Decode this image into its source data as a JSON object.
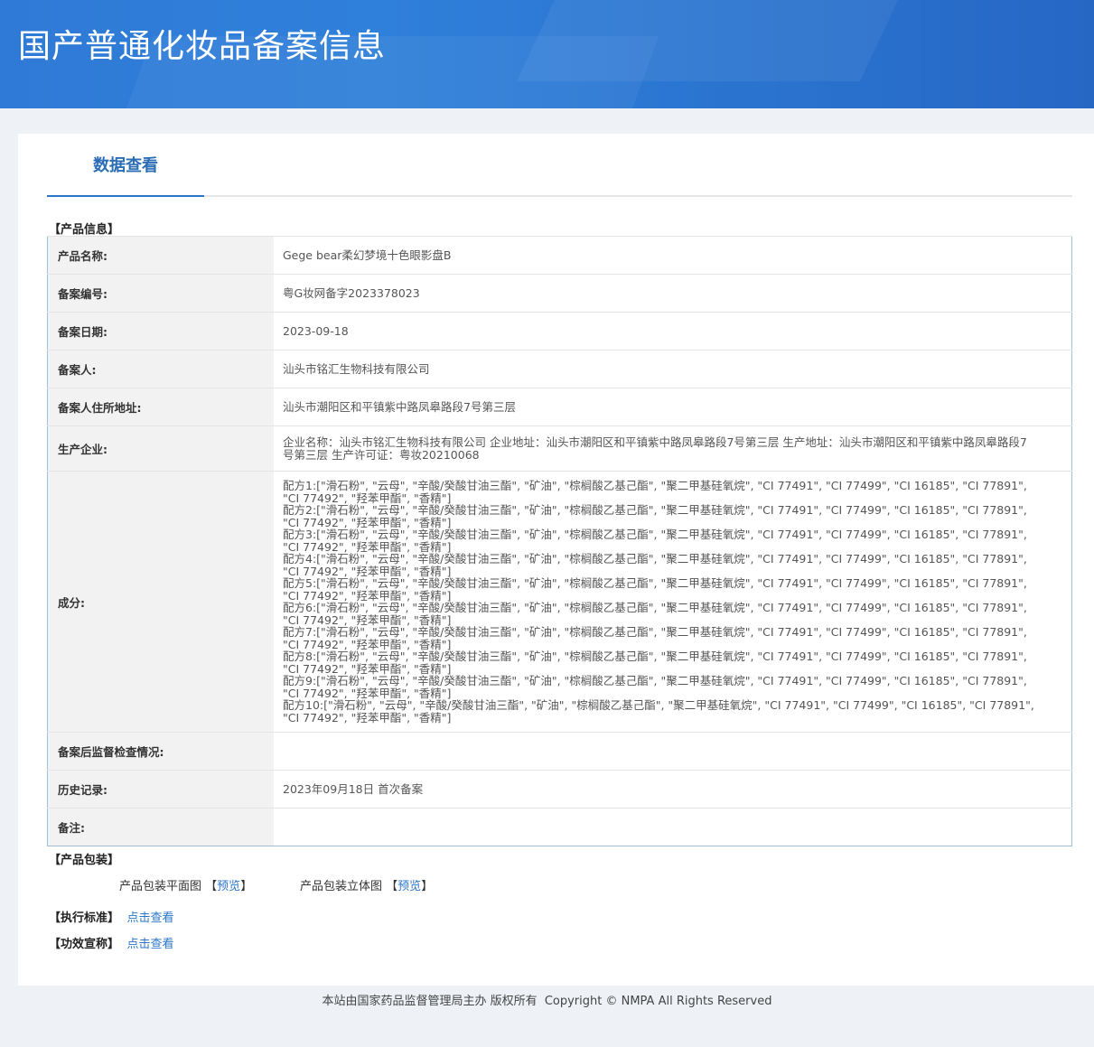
{
  "header": {
    "title": "国产普通化妆品备案信息"
  },
  "tabs": {
    "active": "数据查看"
  },
  "product_section": {
    "title": "【产品信息】"
  },
  "rows": {
    "name": {
      "label": "产品名称:",
      "value": "Gege bear柔幻梦境十色眼影盘B"
    },
    "record_no": {
      "label": "备案编号:",
      "value": "粤G妆网备字2023378023"
    },
    "record_date": {
      "label": "备案日期:",
      "value": "2023-09-18"
    },
    "registrant": {
      "label": "备案人:",
      "value": "汕头市铭汇生物科技有限公司"
    },
    "address": {
      "label": "备案人住所地址:",
      "value": "汕头市潮阳区和平镇紫中路凤皋路段7号第三层"
    },
    "manufacturer": {
      "label": "生产企业:",
      "value": "企业名称：汕头市铭汇生物科技有限公司 企业地址：汕头市潮阳区和平镇紫中路凤皋路段7号第三层 生产地址：汕头市潮阳区和平镇紫中路凤皋路段7号第三层 生产许可证：粤妆20210068"
    },
    "ingredients": {
      "label": "成分:",
      "formulas": [
        "配方1:[\"滑石粉\", \"云母\", \"辛酸/癸酸甘油三酯\", \"矿油\", \"棕榈酸乙基己酯\", \"聚二甲基硅氧烷\", \"CI 77491\", \"CI 77499\", \"CI 16185\", \"CI 77891\", \"CI 77492\", \"羟苯甲酯\", \"香精\"]",
        "配方2:[\"滑石粉\", \"云母\", \"辛酸/癸酸甘油三酯\", \"矿油\", \"棕榈酸乙基己酯\", \"聚二甲基硅氧烷\", \"CI 77491\", \"CI 77499\", \"CI 16185\", \"CI 77891\", \"CI 77492\", \"羟苯甲酯\", \"香精\"]",
        "配方3:[\"滑石粉\", \"云母\", \"辛酸/癸酸甘油三酯\", \"矿油\", \"棕榈酸乙基己酯\", \"聚二甲基硅氧烷\", \"CI 77491\", \"CI 77499\", \"CI 16185\", \"CI 77891\", \"CI 77492\", \"羟苯甲酯\", \"香精\"]",
        "配方4:[\"滑石粉\", \"云母\", \"辛酸/癸酸甘油三酯\", \"矿油\", \"棕榈酸乙基己酯\", \"聚二甲基硅氧烷\", \"CI 77491\", \"CI 77499\", \"CI 16185\", \"CI 77891\", \"CI 77492\", \"羟苯甲酯\", \"香精\"]",
        "配方5:[\"滑石粉\", \"云母\", \"辛酸/癸酸甘油三酯\", \"矿油\", \"棕榈酸乙基己酯\", \"聚二甲基硅氧烷\", \"CI 77491\", \"CI 77499\", \"CI 16185\", \"CI 77891\", \"CI 77492\", \"羟苯甲酯\", \"香精\"]",
        "配方6:[\"滑石粉\", \"云母\", \"辛酸/癸酸甘油三酯\", \"矿油\", \"棕榈酸乙基己酯\", \"聚二甲基硅氧烷\", \"CI 77491\", \"CI 77499\", \"CI 16185\", \"CI 77891\", \"CI 77492\", \"羟苯甲酯\", \"香精\"]",
        "配方7:[\"滑石粉\", \"云母\", \"辛酸/癸酸甘油三酯\", \"矿油\", \"棕榈酸乙基己酯\", \"聚二甲基硅氧烷\", \"CI 77491\", \"CI 77499\", \"CI 16185\", \"CI 77891\", \"CI 77492\", \"羟苯甲酯\", \"香精\"]",
        "配方8:[\"滑石粉\", \"云母\", \"辛酸/癸酸甘油三酯\", \"矿油\", \"棕榈酸乙基己酯\", \"聚二甲基硅氧烷\", \"CI 77491\", \"CI 77499\", \"CI 16185\", \"CI 77891\", \"CI 77492\", \"羟苯甲酯\", \"香精\"]",
        "配方9:[\"滑石粉\", \"云母\", \"辛酸/癸酸甘油三酯\", \"矿油\", \"棕榈酸乙基己酯\", \"聚二甲基硅氧烷\", \"CI 77491\", \"CI 77499\", \"CI 16185\", \"CI 77891\", \"CI 77492\", \"羟苯甲酯\", \"香精\"]",
        "配方10:[\"滑石粉\", \"云母\", \"辛酸/癸酸甘油三酯\", \"矿油\", \"棕榈酸乙基己酯\", \"聚二甲基硅氧烷\", \"CI 77491\", \"CI 77499\", \"CI 16185\", \"CI 77891\", \"CI 77492\", \"羟苯甲酯\", \"香精\"]"
      ]
    },
    "post_check": {
      "label": "备案后监督检查情况:",
      "value": ""
    },
    "history": {
      "label": "历史记录:",
      "value": "2023年09月18日 首次备案"
    },
    "remarks": {
      "label": "备注:",
      "value": ""
    }
  },
  "packaging": {
    "title": "【产品包装】",
    "flat_label": "产品包装平面图",
    "flat_link": "预览",
    "solid_label": "产品包装立体图",
    "solid_link": "预览"
  },
  "standard": {
    "title": "【执行标准】",
    "link": "点击查看"
  },
  "efficacy": {
    "title": "【功效宣称】",
    "link": "点击查看"
  },
  "footer": {
    "org": "本站由国家药品监督管理局主办 版权所有",
    "copyright": "Copyright © NMPA All Rights Reserved"
  }
}
